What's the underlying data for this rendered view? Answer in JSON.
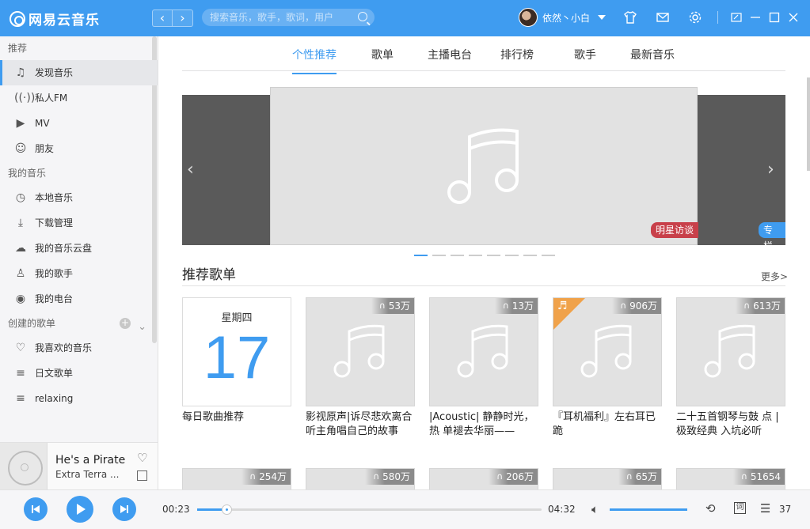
{
  "app": {
    "name": "网易云音乐",
    "accent": "#3f9cf0"
  },
  "titlebar": {
    "back_icon": "chevron-left",
    "forward_icon": "chevron-right",
    "search_placeholder": "搜索音乐，歌手，歌词，用户",
    "username": "依然丶小白",
    "icons": [
      "skin-icon",
      "mail-icon",
      "settings-icon",
      "mini-mode-icon",
      "minimize-icon",
      "maximize-icon",
      "close-icon"
    ]
  },
  "sidebar": {
    "sections": [
      {
        "title": "推荐",
        "items": [
          {
            "label": "发现音乐",
            "icon": "music-note-icon",
            "active": true
          },
          {
            "label": "私人FM",
            "icon": "radio-icon"
          },
          {
            "label": "MV",
            "icon": "video-icon"
          },
          {
            "label": "朋友",
            "icon": "friends-icon"
          }
        ]
      },
      {
        "title": "我的音乐",
        "items": [
          {
            "label": "本地音乐",
            "icon": "local-music-icon"
          },
          {
            "label": "下载管理",
            "icon": "download-icon"
          },
          {
            "label": "我的音乐云盘",
            "icon": "cloud-icon"
          },
          {
            "label": "我的歌手",
            "icon": "artist-icon"
          },
          {
            "label": "我的电台",
            "icon": "podcast-icon"
          }
        ]
      },
      {
        "title": "创建的歌单",
        "items": [
          {
            "label": "我喜欢的音乐",
            "icon": "heart-icon"
          },
          {
            "label": "日文歌单",
            "icon": "playlist-icon"
          },
          {
            "label": "relaxing",
            "icon": "playlist-icon"
          }
        ]
      }
    ]
  },
  "now_playing": {
    "title": "He's a Pirate",
    "artist": "Extra Terra ..."
  },
  "tabs": [
    "个性推荐",
    "歌单",
    "主播电台",
    "排行榜",
    "歌手",
    "最新音乐"
  ],
  "banner": {
    "left_badge": "明星访谈",
    "right_badge": "专栏",
    "dot_count": 8,
    "active_dot": 0
  },
  "recommend": {
    "title": "推荐歌单",
    "more": "更多>",
    "daily": {
      "weekday": "星期四",
      "day": "17",
      "name": "每日歌曲推荐"
    },
    "cards": [
      {
        "count": "53万",
        "name": "影视原声|诉尽悲欢离合 听主角唱自己的故事"
      },
      {
        "count": "13万",
        "name": "|Acoustic| 静静时光，热 单褪去华丽——"
      },
      {
        "count": "906万",
        "name": "『耳机福利』左右耳已 跪",
        "corner": true
      },
      {
        "count": "613万",
        "name": "二十五首钢琴与鼓 点 | 极致经典 入坑必听"
      }
    ],
    "second_row_counts": [
      "254万",
      "580万",
      "206万",
      "65万",
      "51654"
    ]
  },
  "player": {
    "elapsed": "00:23",
    "duration": "04:32",
    "progress_fraction": 0.085,
    "volume_fraction": 1.0,
    "playlist_count": "37",
    "lyric_label": "词"
  }
}
